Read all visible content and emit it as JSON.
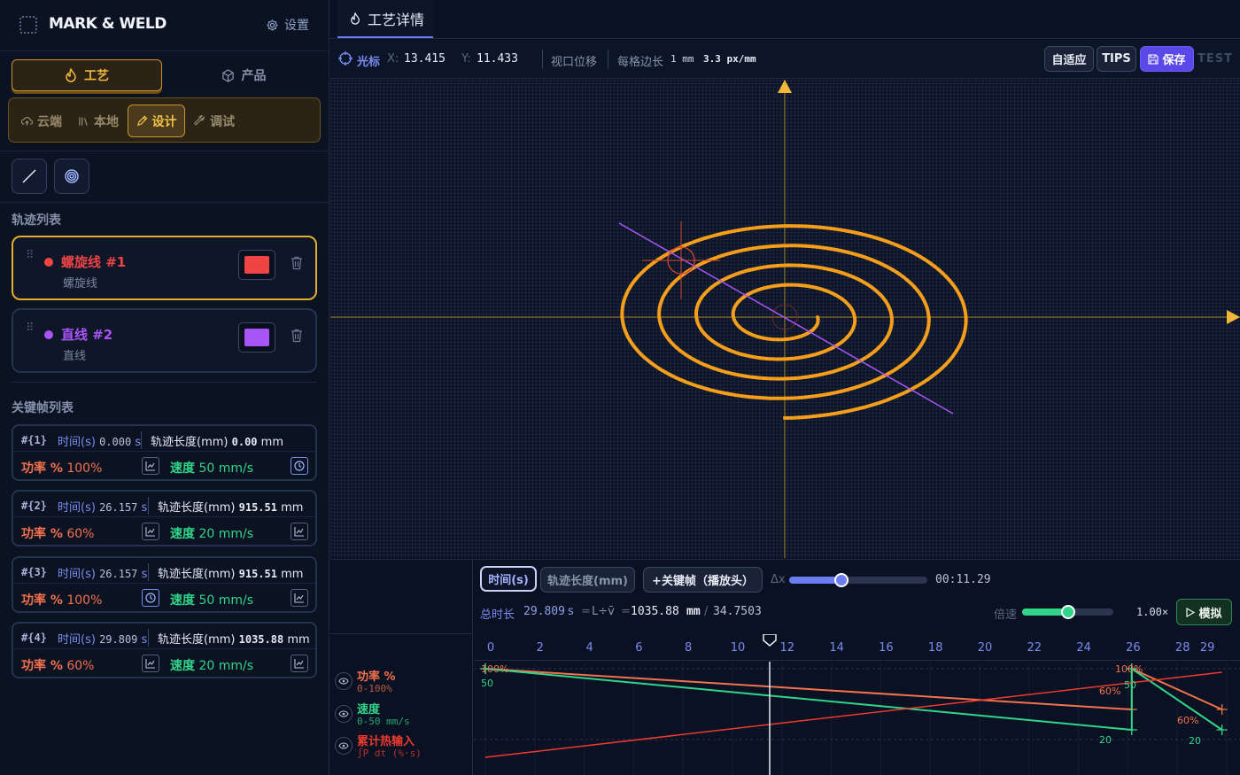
{
  "brand": {
    "name": "MARK & WELD",
    "settings_label": "设置"
  },
  "main_tabs": {
    "craft": "工艺",
    "product": "产品"
  },
  "sub_tabs": {
    "cloud": "云端",
    "local": "本地",
    "design": "设计",
    "debug": "调试"
  },
  "tools": [
    "line-tool",
    "spiral-tool"
  ],
  "track_list": {
    "title": "轨迹列表",
    "items": [
      {
        "name": "螺旋线 #1",
        "type": "螺旋线",
        "color": "#ef4444",
        "selected": true
      },
      {
        "name": "直线 #2",
        "type": "直线",
        "color": "#a855f7",
        "selected": false
      }
    ]
  },
  "keyframe_list": {
    "title": "关键帧列表",
    "time_label": "时间(s)",
    "time_unit": "s",
    "length_label": "轨迹长度(mm)",
    "length_unit": "mm",
    "power_label": "功率 %",
    "speed_label": "速度",
    "speed_unit": "mm/s",
    "items": [
      {
        "id": "#{1}",
        "time": "0.000",
        "length": "0.00",
        "power": "100%",
        "speed": "50",
        "power_icon": "curve-icon",
        "speed_icon": "clock-icon"
      },
      {
        "id": "#{2}",
        "time": "26.157",
        "length": "915.51",
        "power": "60%",
        "speed": "20",
        "power_icon": "curve-icon",
        "speed_icon": "curve-icon"
      },
      {
        "id": "#{3}",
        "time": "26.157",
        "length": "915.51",
        "power": "100%",
        "speed": "50",
        "power_icon": "clock-icon",
        "speed_icon": "curve-icon"
      },
      {
        "id": "#{4}",
        "time": "29.809",
        "length": "1035.88",
        "power": "60%",
        "speed": "20",
        "power_icon": "curve-icon",
        "speed_icon": "curve-icon"
      }
    ]
  },
  "tab": {
    "title": "工艺详情"
  },
  "toolbar": {
    "cursor_label": "光标",
    "x_label": "X:",
    "x_value": "13.415",
    "y_label": "Y:",
    "y_value": "11.433",
    "pan_label": "视口位移",
    "grid_label": "每格边长",
    "grid_size": "1 mm",
    "grid_scale": "3.3 px/mm",
    "fit_label": "自适应",
    "tips_label": "TIPS",
    "save_label": "保存",
    "test_label": "TEST"
  },
  "timeline": {
    "mode_time": "时间(s)",
    "mode_length": "轨迹长度(mm)",
    "add_keyframe": "+关键帧（播放头）",
    "delta_label": "Δx",
    "scrub_fraction": 0.38,
    "playhead_time": "00:11.29",
    "total_label": "总时长",
    "total_value": "29.809",
    "total_unit": "s",
    "formula_eq": "=",
    "formula": "L÷v̄",
    "length_value": "1035.88",
    "length_unit": "mm",
    "slash": "/",
    "ratio": "34.7503",
    "speed_mult_label": "倍速",
    "speed_mult_fraction": 0.5,
    "speed_mult": "1.00×",
    "simulate_label": "模拟",
    "ruler_ticks": [
      "0",
      "2",
      "4",
      "6",
      "8",
      "10",
      "12",
      "14",
      "16",
      "18",
      "20",
      "22",
      "24",
      "26",
      "28",
      "29"
    ],
    "playhead_seconds": 11.29,
    "legend": [
      {
        "name": "功率 %",
        "range": "0-100%",
        "color": "#f3724e"
      },
      {
        "name": "速度",
        "range": "0-50 mm/s",
        "color": "#31d58a"
      },
      {
        "name": "累计热输入",
        "range": "∫P dt (%·s)",
        "color": "#ef3b2e"
      }
    ]
  },
  "chart_data": {
    "type": "line",
    "x_range": [
      0,
      29.809
    ],
    "xlabel": "",
    "ylabel": "",
    "series": [
      {
        "name": "功率 %",
        "x": [
          0,
          26.157,
          26.157,
          29.809
        ],
        "y": [
          100,
          60,
          100,
          60
        ]
      },
      {
        "name": "速度",
        "x": [
          0,
          26.157,
          26.157,
          29.809
        ],
        "y": [
          50,
          20,
          50,
          20
        ]
      },
      {
        "name": "累计热输入",
        "x": [
          0,
          29.809
        ],
        "y": [
          0,
          100
        ]
      }
    ],
    "point_labels": [
      "100%",
      "50",
      "60%",
      "20",
      "100%",
      "50",
      "60%",
      "20"
    ]
  },
  "colors": {
    "accent": "#6c7cf2",
    "spiral": "#f59e1b",
    "line": "#a855f7",
    "axis": "#f3b83a",
    "power": "#f3724e",
    "speed": "#31d58a",
    "heat": "#ef3b2e"
  }
}
